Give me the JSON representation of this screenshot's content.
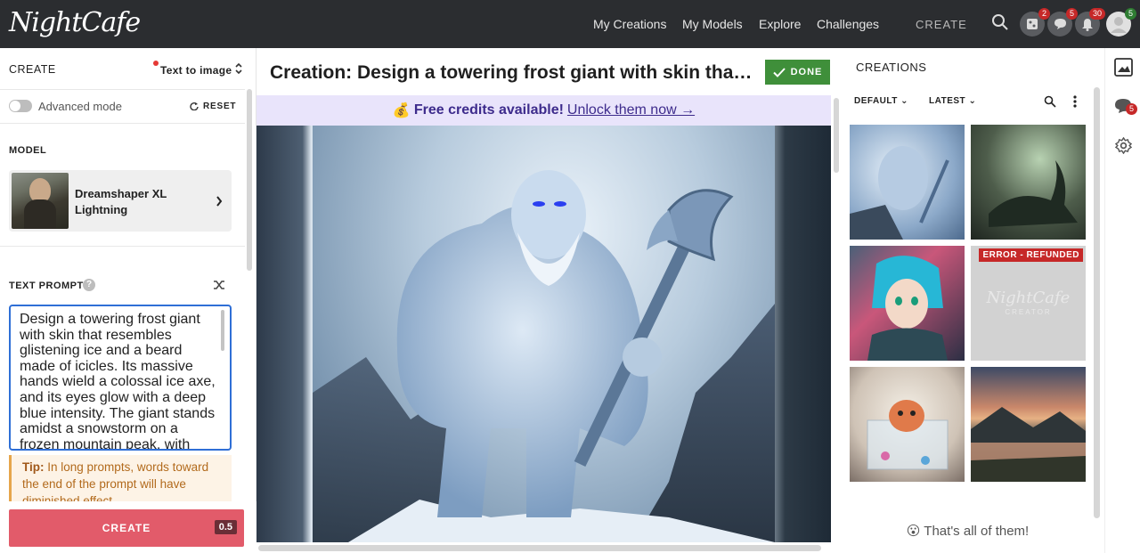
{
  "brand": {
    "logo_text": "NightCafe"
  },
  "nav": {
    "items": [
      "My Creations",
      "My Models",
      "Explore",
      "Challenges"
    ],
    "create_label": "CREATE",
    "badges": {
      "gallery": "2",
      "messages": "5",
      "notifications": "30",
      "profile": "5"
    }
  },
  "left": {
    "header_label": "CREATE",
    "mode_label": "Text to image",
    "advanced_label": "Advanced mode",
    "reset_label": "RESET",
    "model_heading": "MODEL",
    "model_name_1": "Dreamshaper XL",
    "model_name_2": "Lightning",
    "prompt_heading": "TEXT PROMPT",
    "prompt_text": "Design a towering frost giant with skin that resembles glistening ice and a beard made of icicles. Its massive hands wield a colossal ice axe, and its eyes glow with a deep blue intensity. The giant stands amidst a snowstorm on a frozen mountain peak, with swirling",
    "tip_label": "Tip:",
    "tip_text": "In long prompts, words toward the end of the prompt will have diminished effect.",
    "create_button": "CREATE",
    "cost": "0.5"
  },
  "center": {
    "title": "Creation: Design a towering frost giant with skin that resembles glistening ice and a beard made of icicles",
    "done_label": "DONE",
    "banner_emoji": "💰",
    "banner_bold": "Free credits available!",
    "banner_link": "Unlock them now →"
  },
  "right": {
    "heading": "CREATIONS",
    "filter_default": "DEFAULT",
    "filter_latest": "LATEST",
    "error_badge": "ERROR - REFUNDED",
    "placeholder_logo": "NightCafe",
    "placeholder_sub": "CREATOR",
    "end_text": "😮 That's all of them!",
    "side_badge": "5"
  }
}
